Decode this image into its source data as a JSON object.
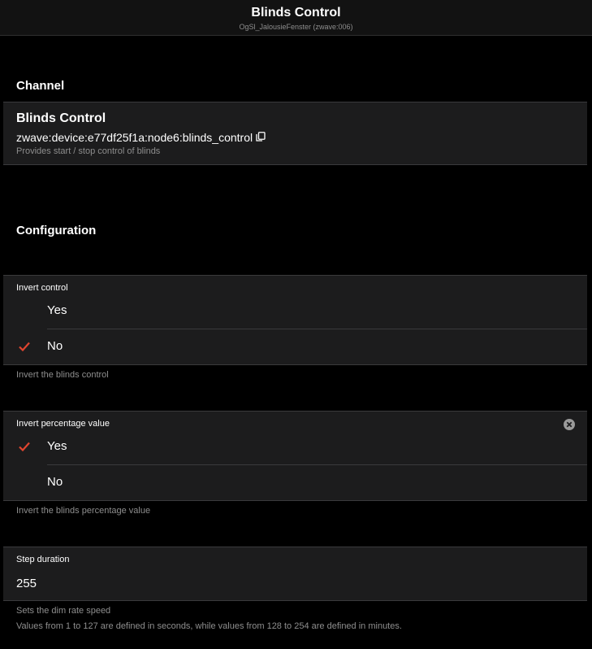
{
  "navbar": {
    "title": "Blinds Control",
    "subtitle": "OgSl_JalousieFenster (zwave:006)"
  },
  "channel_section": {
    "title": "Channel",
    "channel": {
      "name": "Blinds Control",
      "uid": "zwave:device:e77df25f1a:node6:blinds_control",
      "copy_icon": "copy-icon",
      "description": "Provides start / stop control of blinds"
    }
  },
  "configuration_section": {
    "title": "Configuration",
    "invert_control": {
      "label": "Invert control",
      "options": [
        {
          "label": "Yes",
          "selected": false
        },
        {
          "label": "No",
          "selected": true
        }
      ],
      "footer": "Invert the blinds control"
    },
    "invert_percentage": {
      "label": "Invert percentage value",
      "clear_icon": "clear-icon",
      "options": [
        {
          "label": "Yes",
          "selected": true
        },
        {
          "label": "No",
          "selected": false
        }
      ],
      "footer": "Invert the blinds percentage value"
    },
    "step_duration": {
      "label": "Step duration",
      "value": "255",
      "footer_line1": "Sets the dim rate speed",
      "footer_line2": "Values from 1 to 127 are defined in seconds, while values from 128 to 254 are defined in minutes."
    }
  },
  "colors": {
    "background": "#000000",
    "card": "#1c1c1d",
    "accent_check": "#e0452f",
    "secondary_text": "#8e8e8e"
  }
}
